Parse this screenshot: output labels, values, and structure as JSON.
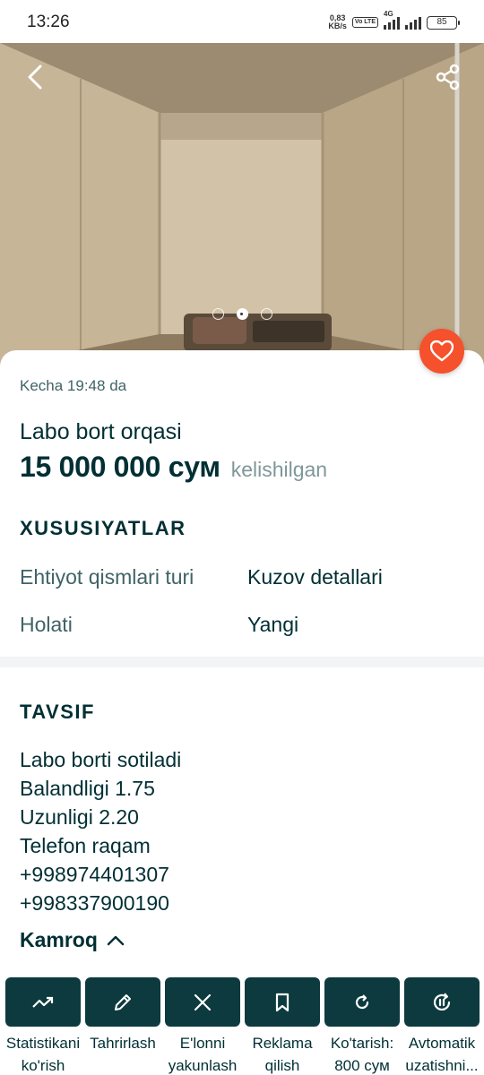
{
  "status_bar": {
    "time": "13:26",
    "net_speed_value": "0,83",
    "net_speed_unit": "KB/s",
    "volte": "Vo LTE",
    "net_type": "4G",
    "battery": "85"
  },
  "gallery": {
    "image_count": 3,
    "active_index": 1,
    "back_icon": "back-arrow-icon",
    "share_icon": "share-icon",
    "favorite_icon": "heart-icon",
    "favorite_color": "#f4512c"
  },
  "ad": {
    "posted": "Kecha 19:48 da",
    "title": "Labo bort orqasi",
    "price": "15 000 000 сум",
    "negotiable": "kelishilgan"
  },
  "properties": {
    "title": "XUSUSIYATLAR",
    "items": [
      {
        "label": "Ehtiyot qismlari turi",
        "value": "Kuzov detallari"
      },
      {
        "label": "Holati",
        "value": "Yangi"
      }
    ]
  },
  "description": {
    "title": "TAVSIF",
    "lines": [
      "Labo borti sotiladi",
      "Balandligi 1.75",
      "Uzunligi 2.20",
      "Telefon raqam",
      "+998974401307",
      "+998337900190"
    ],
    "less_label": "Kamroq"
  },
  "actions": [
    {
      "label": "Statistikani\nko'rish",
      "icon": "trend-up-icon"
    },
    {
      "label": "Tahrirlash",
      "icon": "pencil-icon"
    },
    {
      "label": "E'lonni\nyakunlash",
      "icon": "close-icon"
    },
    {
      "label": "Reklama\nqilish",
      "icon": "bookmark-icon"
    },
    {
      "label": "Ko'tarish:\n800 сум",
      "icon": "refresh-icon"
    },
    {
      "label": "Avtomatik\nuzatishni...",
      "icon": "auto-renew-icon"
    }
  ],
  "colors": {
    "primary_dark": "#002f34",
    "action_button": "#0d3a3e",
    "accent": "#f4512c",
    "muted_text": "#406367"
  }
}
